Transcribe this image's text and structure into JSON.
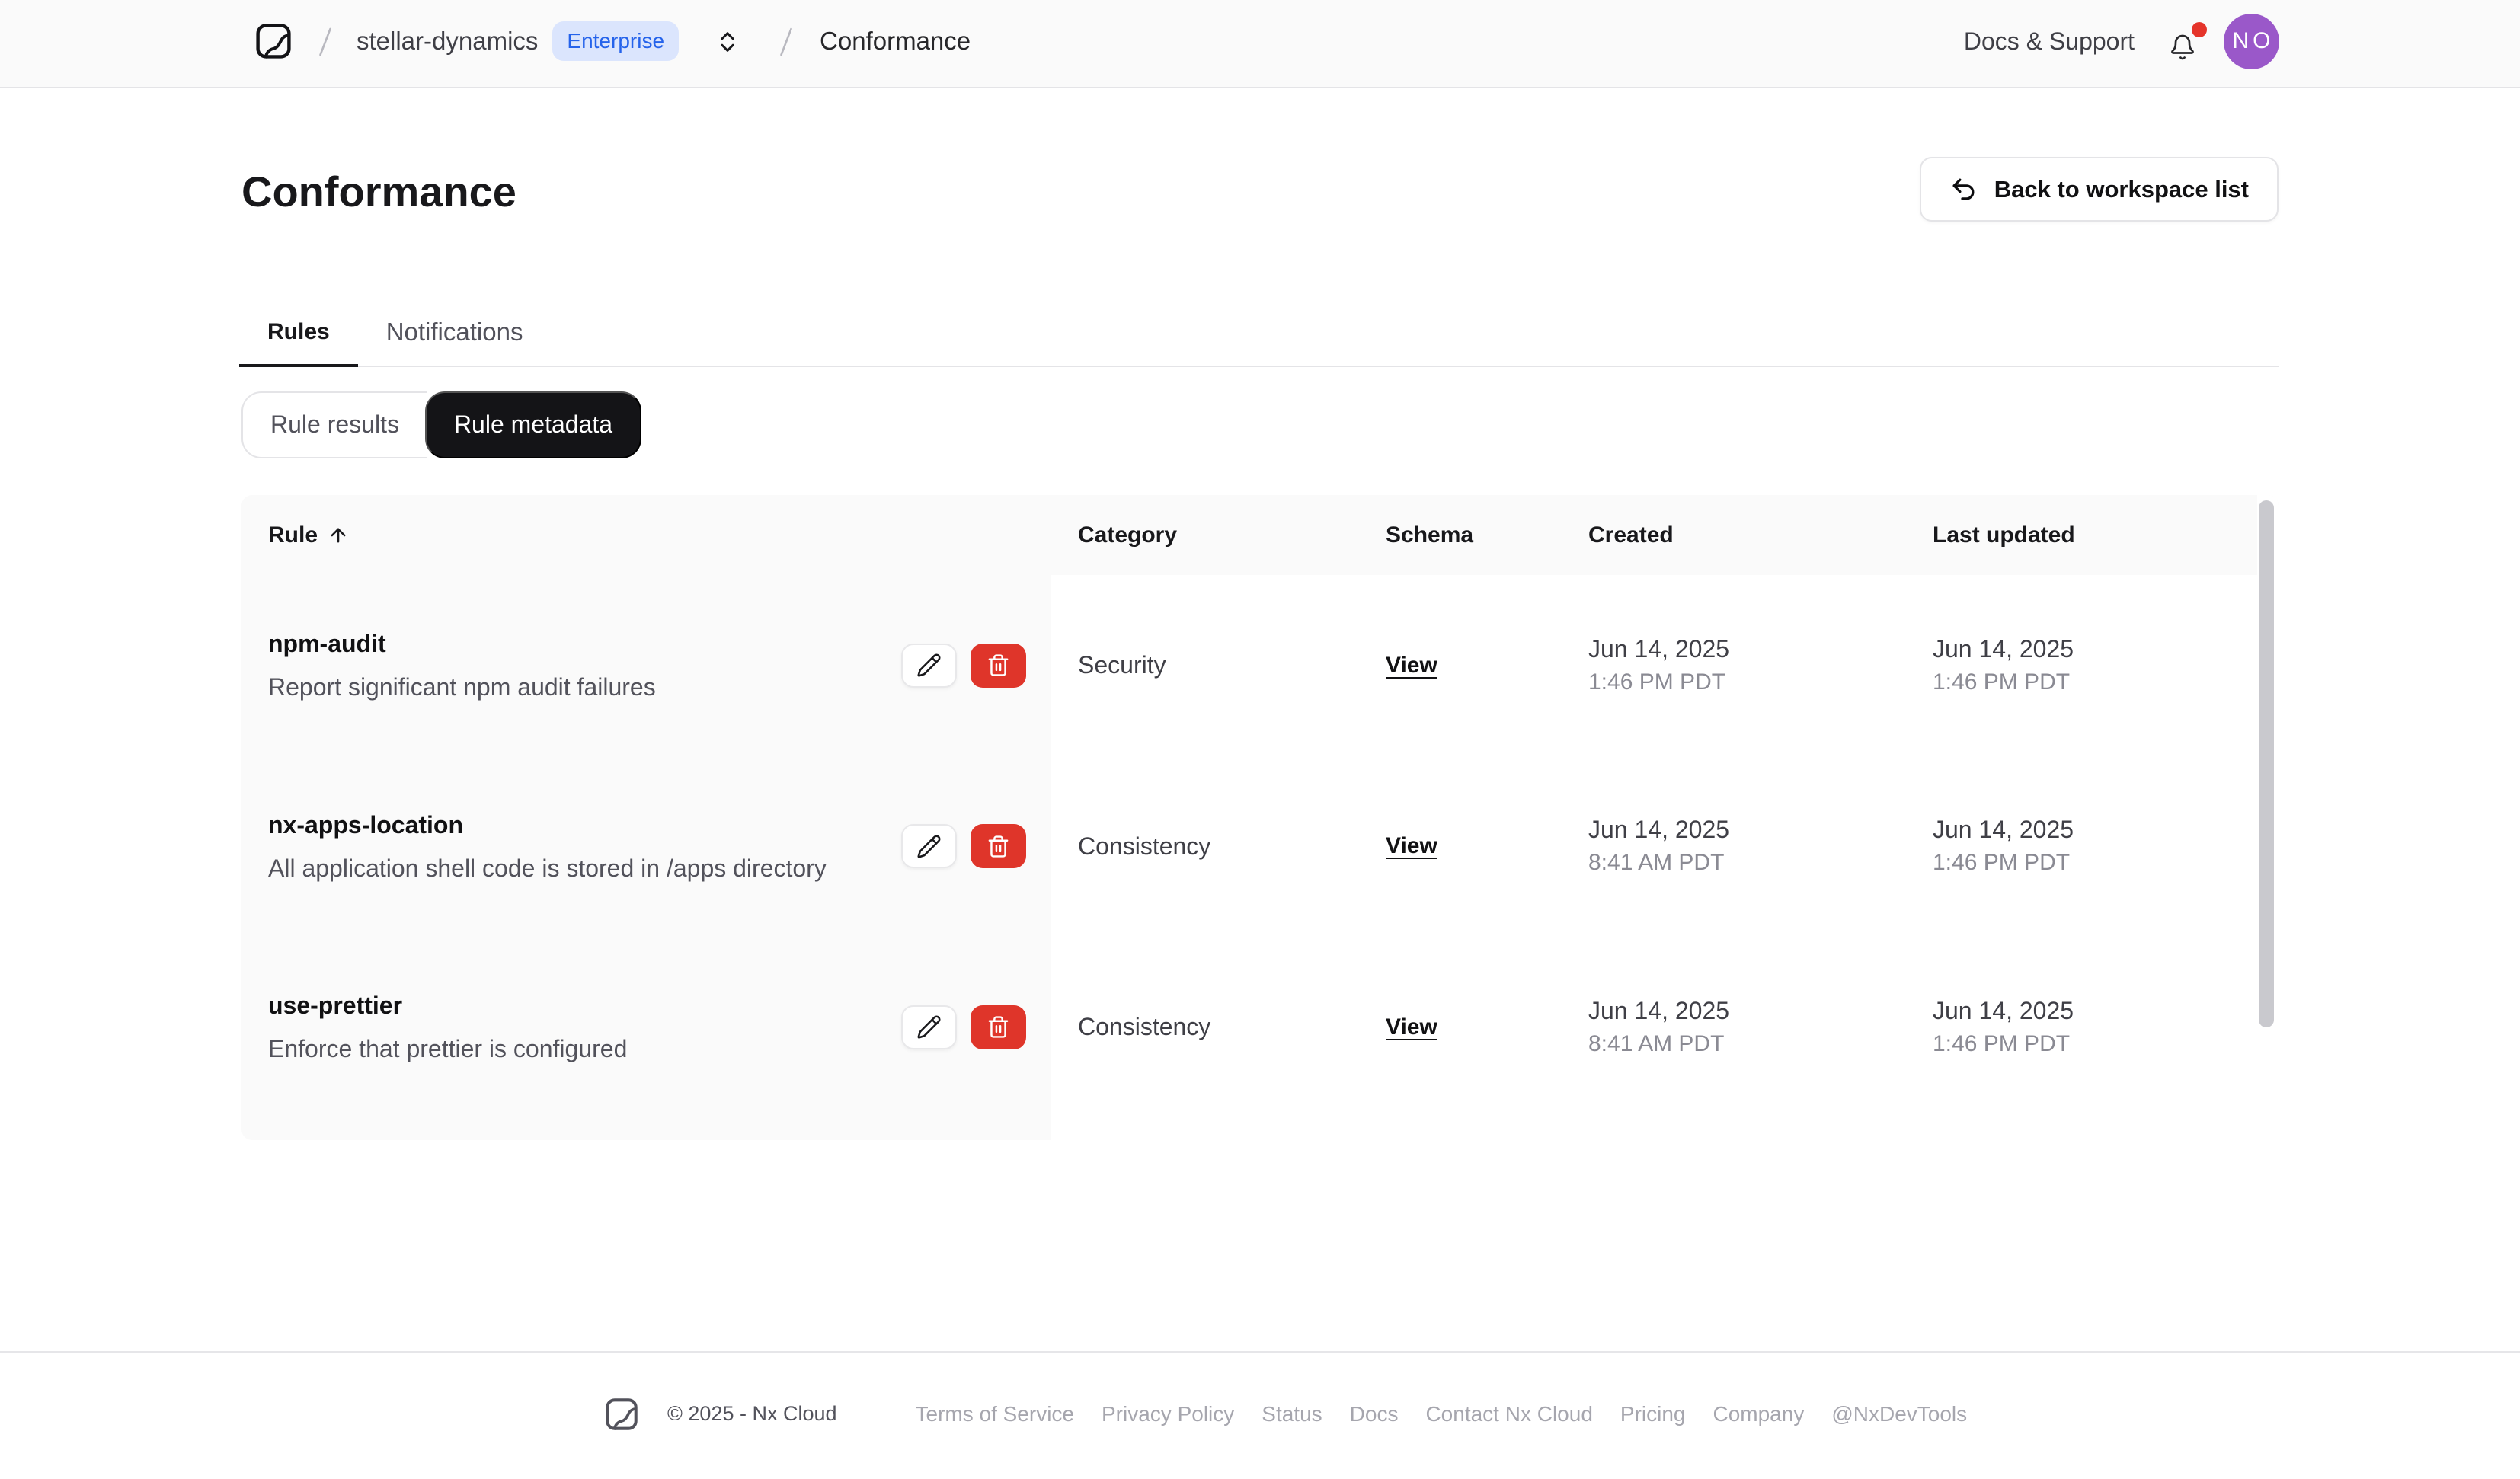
{
  "topbar": {
    "org": "stellar-dynamics",
    "org_badge": "Enterprise",
    "page": "Conformance",
    "docs_support": "Docs & Support",
    "avatar_initials": "NO"
  },
  "header": {
    "title": "Conformance",
    "back_button": "Back to workspace list"
  },
  "tabs": [
    {
      "label": "Rules",
      "active": true
    },
    {
      "label": "Notifications",
      "active": false
    }
  ],
  "view_toggle": [
    {
      "label": "Rule results",
      "active": false
    },
    {
      "label": "Rule metadata",
      "active": true
    }
  ],
  "table": {
    "columns": [
      "Rule",
      "Category",
      "Schema",
      "Created",
      "Last updated"
    ],
    "schema_link_label": "View",
    "rows": [
      {
        "name": "npm-audit",
        "description": "Report significant npm audit failures",
        "category": "Security",
        "schema": "View",
        "created_date": "Jun 14, 2025",
        "created_time": "1:46 PM PDT",
        "updated_date": "Jun 14, 2025",
        "updated_time": "1:46 PM PDT"
      },
      {
        "name": "nx-apps-location",
        "description": "All application shell code is stored in /apps directory",
        "category": "Consistency",
        "schema": "View",
        "created_date": "Jun 14, 2025",
        "created_time": "8:41 AM PDT",
        "updated_date": "Jun 14, 2025",
        "updated_time": "1:46 PM PDT"
      },
      {
        "name": "use-prettier",
        "description": "Enforce that prettier is configured",
        "category": "Consistency",
        "schema": "View",
        "created_date": "Jun 14, 2025",
        "created_time": "8:41 AM PDT",
        "updated_date": "Jun 14, 2025",
        "updated_time": "1:46 PM PDT"
      }
    ]
  },
  "footer": {
    "copyright": "© 2025 - Nx Cloud",
    "links": [
      "Terms of Service",
      "Privacy Policy",
      "Status",
      "Docs",
      "Contact Nx Cloud",
      "Pricing",
      "Company",
      "@NxDevTools"
    ]
  },
  "colors": {
    "accent_blue": "#2563eb",
    "badge_bg": "#dbe5fd",
    "danger_red": "#df352a",
    "notification_red": "#e5342a",
    "avatar_purple": "#9a58c9",
    "active_pill": "#141417"
  }
}
